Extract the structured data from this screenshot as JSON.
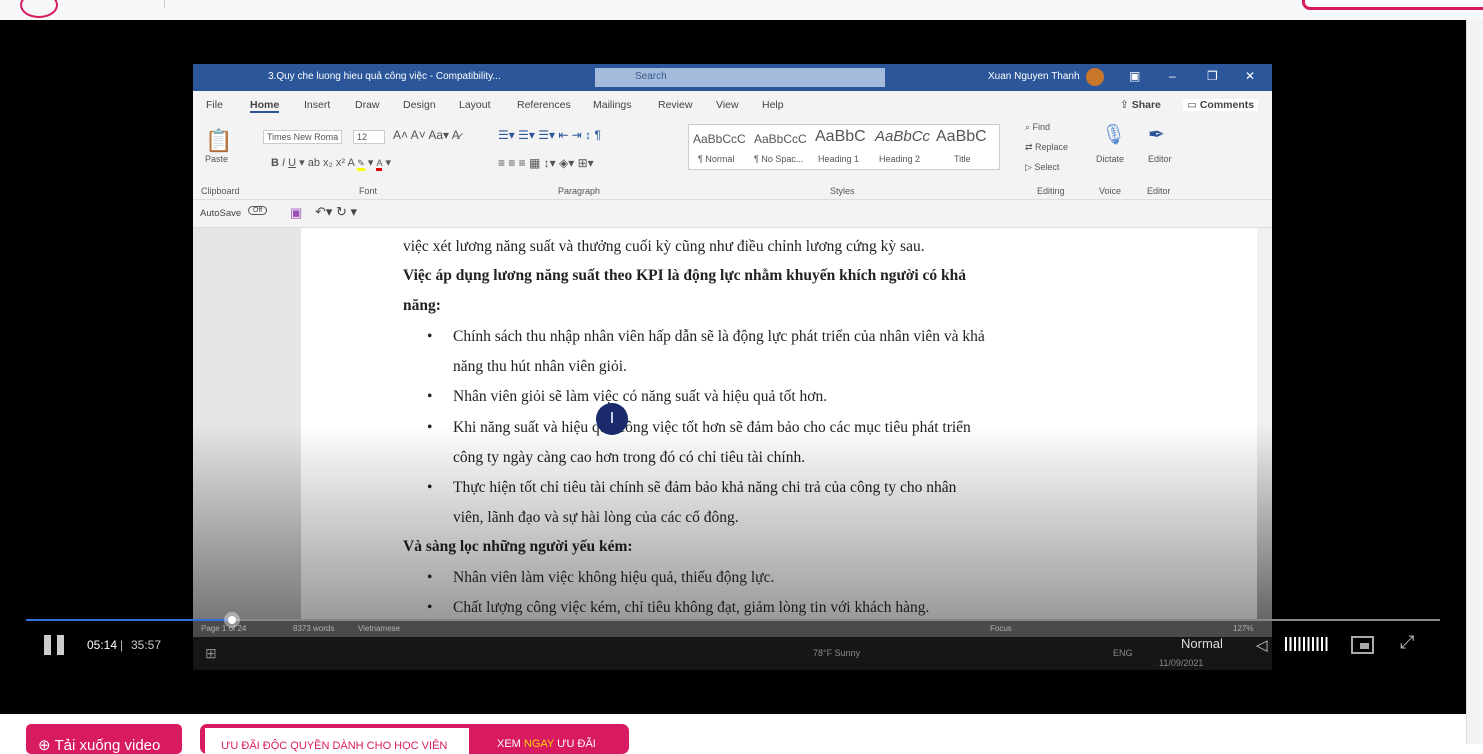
{
  "site": {
    "top_button": ""
  },
  "word": {
    "title": "3.Quy che luong hieu quả công việc  -  Compatibility...",
    "search": "Search",
    "user": "Xuan Nguyen Thanh",
    "tabs": [
      "File",
      "Home",
      "Insert",
      "Draw",
      "Design",
      "Layout",
      "References",
      "Mailings",
      "Review",
      "View",
      "Help"
    ],
    "share": "Share",
    "comments": "Comments",
    "font_name": "Times New Roma",
    "font_size": "12",
    "groups": [
      "Clipboard",
      "Font",
      "Paragraph",
      "Styles",
      "Editing",
      "Voice",
      "Editor"
    ],
    "paste": "Paste",
    "styles": [
      {
        "sample": "AaBbCcC",
        "name": "¶ Normal"
      },
      {
        "sample": "AaBbCcC",
        "name": "¶ No Spac..."
      },
      {
        "sample": "AaBbC",
        "name": "Heading 1"
      },
      {
        "sample": "AaBbCc",
        "name": "Heading 2"
      },
      {
        "sample": "AaBbC",
        "name": "Title"
      }
    ],
    "editing": [
      "Find",
      "Replace",
      "Select"
    ],
    "dictate": "Dictate",
    "editor": "Editor",
    "autosave": "AutoSave",
    "autosave_state": "Off",
    "status": {
      "page": "Page 1 of 24",
      "words": "8373 words",
      "lang": "Vietnamese",
      "focus": "Focus",
      "zoom": "127%"
    },
    "taskbar": {
      "weather": "78°F Sunny",
      "lang": "ENG",
      "date": "11/09/2021"
    }
  },
  "doc": {
    "lines": [
      "việc xét lương năng suất và thưởng cuối kỳ cũng như điều chỉnh lương cứng kỳ sau.",
      "Việc áp dụng lương năng suất theo KPI là động lực nhằm khuyến khích người có khả",
      "năng:",
      "Chính sách thu nhập nhân viên hấp dẫn sẽ là động lực phát triển của nhân viên và khả",
      "năng thu hút nhân viên giỏi.",
      "Nhân viên giỏi sẽ làm việc có năng suất và hiệu quả tốt hơn.",
      "Khi năng suất và hiệu quả công việc tốt hơn sẽ đảm bảo cho các mục tiêu phát triển",
      "công ty ngày càng cao hơn trong đó có chỉ tiêu tài chính.",
      "Thực hiện tốt chỉ tiêu tài chính sẽ đảm bảo khả năng chi trả của công ty cho nhân",
      "viên, lãnh đạo và sự hài lòng của các cổ đông.",
      "Và sàng lọc những người yếu kém:",
      "Nhân viên làm việc không hiệu quả, thiếu động lực.",
      "Chất lượng công việc kém, chỉ tiêu không đạt, giảm lòng tin với khách hàng."
    ]
  },
  "player": {
    "current": "05:14",
    "separator": "|",
    "duration": "35:57",
    "progress_fraction": 0.146,
    "speed": "Normal",
    "volume_fraction": 1.0
  },
  "actions": {
    "download": "Tải xuống video",
    "promo_left": "ƯU ĐÃI ĐỘC QUYỀN DÀNH CHO HỌC VIÊN",
    "promo_right_a": "XEM ",
    "promo_right_b": "NGAY",
    "promo_right_c": " ƯU ĐÃI"
  },
  "colors": {
    "accent": "#d81b60",
    "word_blue": "#2b579a",
    "progress": "#2f6fe0"
  }
}
